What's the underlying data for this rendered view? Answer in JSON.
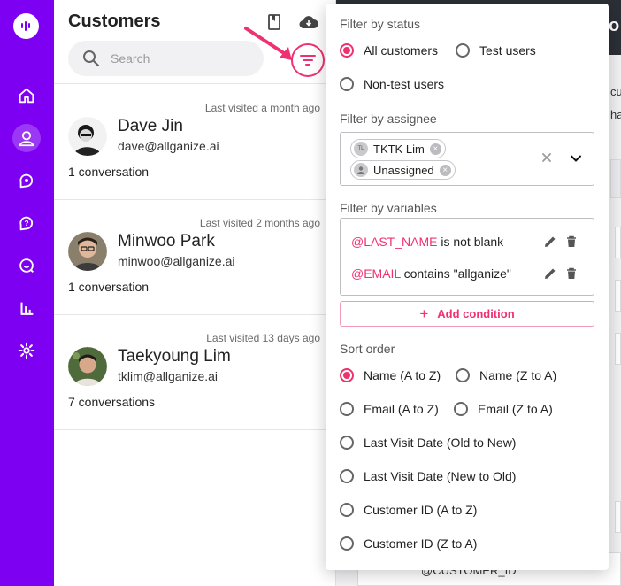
{
  "panel": {
    "title": "Customers",
    "search_placeholder": "Search"
  },
  "customers": [
    {
      "last_visited": "Last visited a month ago",
      "name": "Dave Jin",
      "email": "dave@allganize.ai",
      "conversations": "1 conversation"
    },
    {
      "last_visited": "Last visited 2 months ago",
      "name": "Minwoo Park",
      "email": "minwoo@allganize.ai",
      "conversations": "1 conversation"
    },
    {
      "last_visited": "Last visited 13 days ago",
      "name": "Taekyoung Lim",
      "email": "tklim@allganize.ai",
      "conversations": "7 conversations"
    }
  ],
  "background": {
    "topbar_fragment": "o",
    "fragment_1": "cu",
    "fragment_2": "ha",
    "fragment_3": "@CUSTOMER_ID"
  },
  "filter": {
    "status_title": "Filter by status",
    "status_options": [
      "All customers",
      "Test users",
      "Non-test users"
    ],
    "status_selected": "All customers",
    "assignee_title": "Filter by assignee",
    "assignees": [
      {
        "label": "TKTK Lim",
        "initials": "TL"
      },
      {
        "label": "Unassigned",
        "initials": ""
      }
    ],
    "variables_title": "Filter by variables",
    "conditions": [
      {
        "variable": "@LAST_NAME",
        "rest": " is not blank"
      },
      {
        "variable": "@EMAIL",
        "rest": " contains \"allganize\""
      }
    ],
    "add_condition": "Add condition",
    "sort_title": "Sort order",
    "sort_options": [
      "Name (A to Z)",
      "Name (Z to A)",
      "Email (A to Z)",
      "Email (Z to A)",
      "Last Visit Date (Old to New)",
      "Last Visit Date (New to Old)",
      "Customer ID (A to Z)",
      "Customer ID (Z to A)"
    ],
    "sort_selected": "Name (A to Z)"
  },
  "colors": {
    "rail": "#7e00f2",
    "accent": "#f0316f",
    "topbar": "#2b2f36"
  },
  "icons": [
    "logo-icon",
    "home-icon",
    "customers-icon",
    "conversations-icon",
    "faq-icon",
    "chat-icon",
    "stats-icon",
    "settings-icon",
    "book-icon",
    "cloud-download-icon",
    "search-icon",
    "filter-icon",
    "clear-icon",
    "chevron-down-icon",
    "edit-icon",
    "delete-icon"
  ]
}
